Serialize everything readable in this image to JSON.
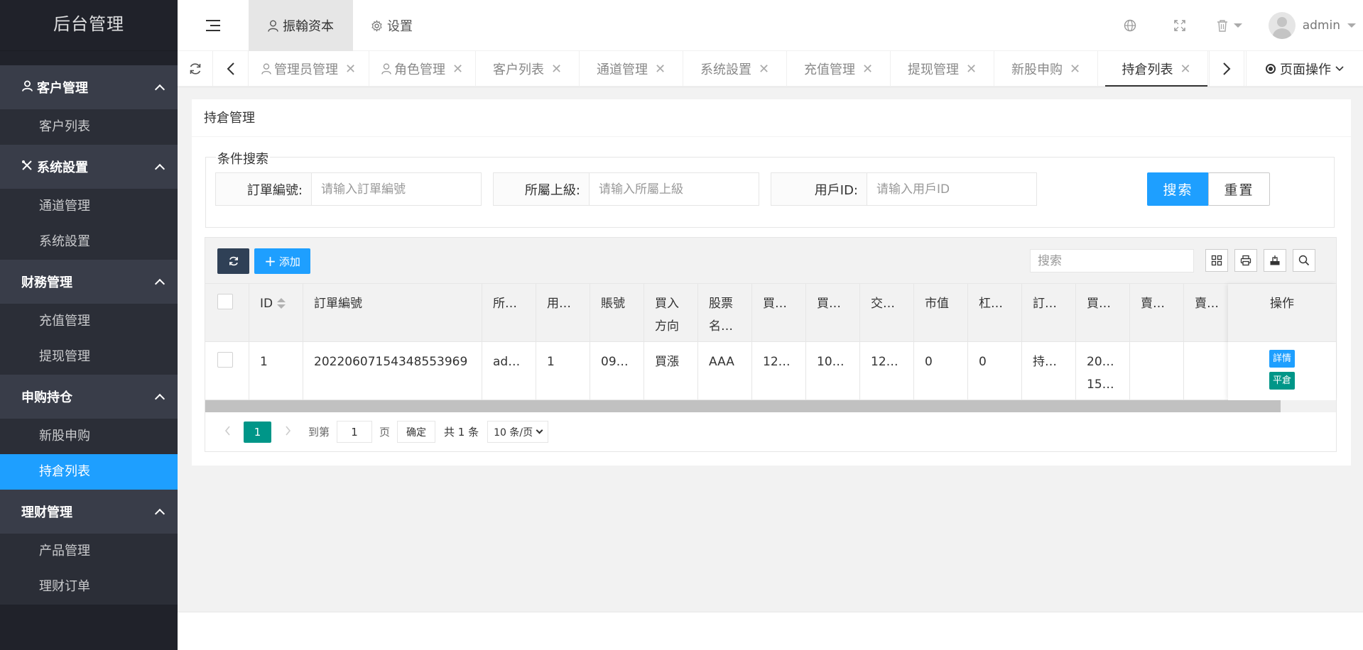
{
  "sidebar": {
    "logo": "后台管理",
    "groups": [
      {
        "label": "客户管理",
        "icon": "user-icon",
        "items": [
          "客户列表"
        ]
      },
      {
        "label": "系统設置",
        "icon": "tools-icon",
        "items": [
          "通道管理",
          "系统設置"
        ]
      },
      {
        "label": "财務管理",
        "icon": "",
        "items": [
          "充值管理",
          "提现管理"
        ]
      },
      {
        "label": "申购持仓",
        "icon": "",
        "items": [
          "新股申购",
          "持倉列表"
        ]
      },
      {
        "label": "理财管理",
        "icon": "",
        "items": [
          "产品管理",
          "理财订单"
        ]
      }
    ],
    "active_item": "持倉列表"
  },
  "header": {
    "tabs": [
      {
        "label": "振翰资本",
        "icon": "user-icon",
        "active": true
      },
      {
        "label": "设置",
        "icon": "gear-icon",
        "active": false
      }
    ],
    "user": "admin"
  },
  "tabbar": {
    "tabs": [
      {
        "label": "管理员管理",
        "icon": "user-icon"
      },
      {
        "label": "角色管理",
        "icon": "user-icon"
      },
      {
        "label": "客户列表",
        "icon": ""
      },
      {
        "label": "通道管理",
        "icon": ""
      },
      {
        "label": "系统設置",
        "icon": ""
      },
      {
        "label": "充值管理",
        "icon": ""
      },
      {
        "label": "提现管理",
        "icon": ""
      },
      {
        "label": "新股申购",
        "icon": ""
      },
      {
        "label": "持倉列表",
        "icon": "",
        "active": true
      }
    ],
    "page_ops": "页面操作"
  },
  "card": {
    "title": "持倉管理",
    "legend": "条件搜索",
    "search": [
      {
        "label": "訂單編號:",
        "placeholder": "请输入訂單編號"
      },
      {
        "label": "所屬上級:",
        "placeholder": "请输入所屬上級"
      },
      {
        "label": "用戶ID:",
        "placeholder": "请输入用戶ID"
      }
    ],
    "search_btn": "搜索",
    "reset_btn": "重置"
  },
  "table": {
    "add_label": "添加",
    "search_placeholder": "搜索",
    "columns": [
      {
        "lines": [
          "ID"
        ]
      },
      {
        "lines": [
          "訂單編號"
        ]
      },
      {
        "lines": [
          "所…"
        ]
      },
      {
        "lines": [
          "用…"
        ]
      },
      {
        "lines": [
          "賬號"
        ]
      },
      {
        "lines": [
          "買入",
          "方向"
        ]
      },
      {
        "lines": [
          "股票",
          "名…"
        ]
      },
      {
        "lines": [
          "買…"
        ]
      },
      {
        "lines": [
          "買…"
        ]
      },
      {
        "lines": [
          "交…"
        ]
      },
      {
        "lines": [
          "市值"
        ]
      },
      {
        "lines": [
          "杠…"
        ]
      },
      {
        "lines": [
          "訂…"
        ]
      },
      {
        "lines": [
          "買…"
        ]
      },
      {
        "lines": [
          "賣…"
        ]
      },
      {
        "lines": [
          "賣…"
        ]
      }
    ],
    "ops_header": "操作",
    "rows": [
      {
        "cells": [
          [
            "1"
          ],
          [
            "20220607154348553969"
          ],
          [
            "ad…"
          ],
          [
            "1"
          ],
          [
            "09…"
          ],
          [
            "買漲"
          ],
          [
            "AAA"
          ],
          [
            "12…"
          ],
          [
            "10…"
          ],
          [
            "12…"
          ],
          [
            "0"
          ],
          [
            "0"
          ],
          [
            "持…"
          ],
          [
            "20…",
            "15…"
          ],
          [
            ""
          ],
          [
            ""
          ]
        ],
        "ops": [
          "詳情",
          "平倉"
        ]
      }
    ]
  },
  "pager": {
    "current": "1",
    "goto_label": "到第",
    "goto_value": "1",
    "page_unit": "页",
    "ok": "确定",
    "total": "共 1 条",
    "per_page": "10 条/页"
  },
  "colors": {
    "sidebar_bg": "#20222a",
    "group_bg": "#393d49",
    "active_blue": "#1e9fff",
    "pager_green": "#009688",
    "toolbar_dark": "#2f4056"
  }
}
